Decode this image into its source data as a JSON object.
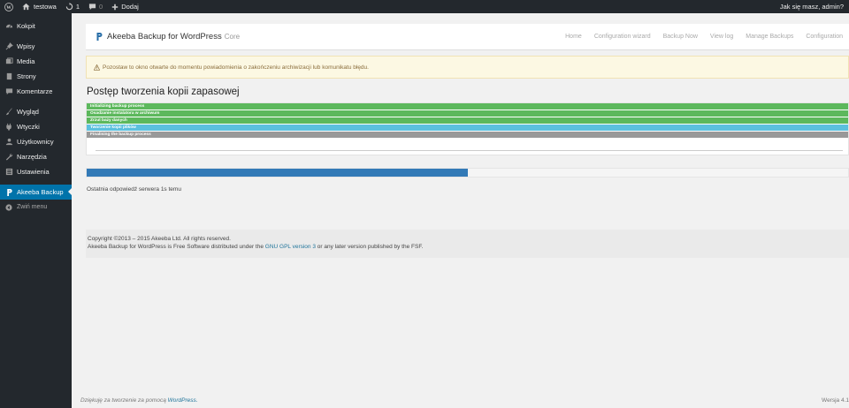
{
  "adminbar": {
    "site_name": "testowa",
    "updates_count": "1",
    "comments_count": "0",
    "add_new": "Dodaj",
    "greeting": "Jak się masz, admin?"
  },
  "sidebar": {
    "items": [
      {
        "label": "Kokpit",
        "icon": "dashboard-icon"
      },
      {
        "label": "Wpisy",
        "icon": "pin-icon"
      },
      {
        "label": "Media",
        "icon": "media-icon"
      },
      {
        "label": "Strony",
        "icon": "page-icon"
      },
      {
        "label": "Komentarze",
        "icon": "comment-icon"
      },
      {
        "label": "Wygląd",
        "icon": "brush-icon"
      },
      {
        "label": "Wtyczki",
        "icon": "plugin-icon"
      },
      {
        "label": "Użytkownicy",
        "icon": "user-icon"
      },
      {
        "label": "Narzędzia",
        "icon": "wrench-icon"
      },
      {
        "label": "Ustawienia",
        "icon": "settings-icon"
      },
      {
        "label": "Akeeba Backup",
        "icon": "akeeba-icon"
      }
    ],
    "collapse_label": "Zwiń menu"
  },
  "akeeba_nav": {
    "brand": "Akeeba Backup for WordPress",
    "edition": "Core",
    "links": [
      "Home",
      "Configuration wizard",
      "Backup Now",
      "View log",
      "Manage Backups",
      "Configuration"
    ]
  },
  "notice": {
    "text": "Pozostaw to okno otwarte do momentu powiadomienia o zakończeniu archiwizacji lub komunikatu błędu."
  },
  "page_title": "Postęp tworzenia kopii zapasowej",
  "steps": [
    {
      "label": "Initializing backup process",
      "state": "done"
    },
    {
      "label": "Osadzanie instalatora w archiwum",
      "state": "done"
    },
    {
      "label": "Zrzut bazy danych",
      "state": "done"
    },
    {
      "label": "Tworzenie kopii plików",
      "state": "running"
    },
    {
      "label": "Finalising the backup process",
      "state": "pending"
    }
  ],
  "progress": {
    "percent": 50,
    "color": "#337ab7"
  },
  "last_response": "Ostatnia odpowiedź serwera 1s temu",
  "footer": {
    "copyright": "Copyright ©2013 – 2015 Akeeba Ltd. All rights reserved.",
    "license_prefix": "Akeeba Backup for WordPress is Free Software distributed under the",
    "license_link": "GNU GPL version 3",
    "license_suffix": "or any later version published by the FSF."
  },
  "wp_footer": {
    "thanks_prefix": "Dziękuję za tworzenie za pomocą",
    "thanks_link": "WordPress.",
    "version": "Wersja 4.1"
  }
}
